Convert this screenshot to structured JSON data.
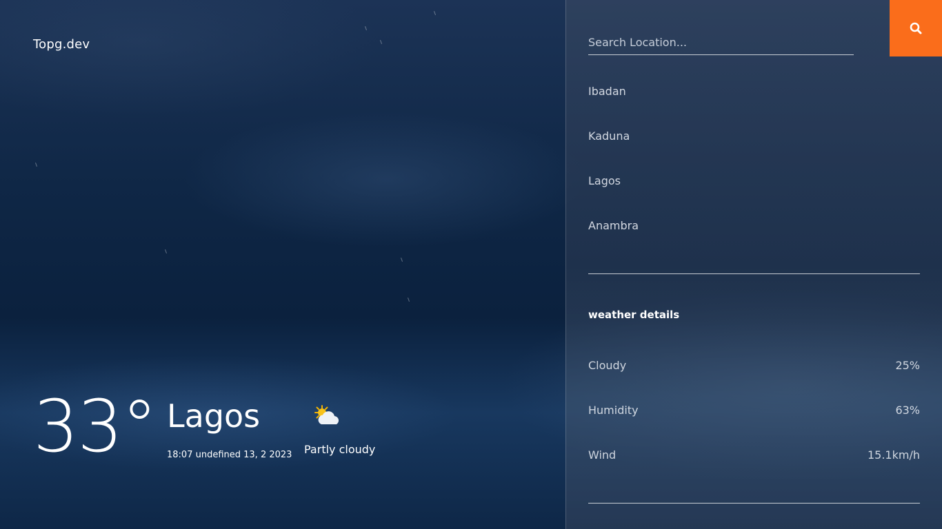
{
  "brand": "Topg.dev",
  "current": {
    "temperature": "33°",
    "city": "Lagos",
    "datetime": "18:07 undefined 13, 2 2023",
    "condition": "Partly cloudy",
    "condition_icon": "partly-cloudy-icon"
  },
  "search": {
    "placeholder": "Search Location...",
    "value": "",
    "button_icon": "search-icon"
  },
  "cities": [
    {
      "label": "Ibadan"
    },
    {
      "label": "Kaduna"
    },
    {
      "label": "Lagos"
    },
    {
      "label": "Anambra"
    }
  ],
  "details": {
    "title": "weather details",
    "items": [
      {
        "label": "Cloudy",
        "value": "25%"
      },
      {
        "label": "Humidity",
        "value": "63%"
      },
      {
        "label": "Wind",
        "value": "15.1km/h"
      }
    ]
  },
  "colors": {
    "accent": "#fa6d1b",
    "text": "#ffffff",
    "background": "#0f2746"
  }
}
